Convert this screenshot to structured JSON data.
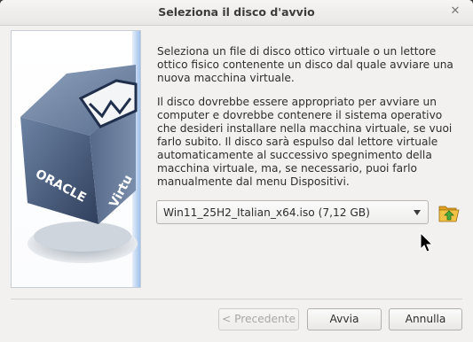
{
  "window": {
    "title": "Seleziona il disco d'avvio",
    "close_glyph": "✕"
  },
  "image": {
    "logo_text_1": "ORACLE",
    "logo_text_2": "Virtu"
  },
  "content": {
    "paragraph1": "Seleziona un file di disco ottico virtuale o un lettore ottico fisico contenente un disco dal quale avviare una nuova macchina virtuale.",
    "paragraph2": "Il disco dovrebbe essere appropriato per avviare un computer e dovrebbe contenere il sistema operativo che desideri installare nella macchina virtuale, se vuoi farlo subito. Il disco sarà espulso dal lettore virtuale automaticamente al successivo spegnimento della macchina virtuale, ma, se necessario, puoi farlo manualmente dal menu Dispositivi."
  },
  "disk_selector": {
    "selected": "Win11_25H2_Italian_x64.iso (7,12 GB)"
  },
  "buttons": {
    "previous": "< Precedente",
    "start": "Avvia",
    "cancel": "Annulla"
  },
  "icons": {
    "folder": "folder-open-icon",
    "close": "close-icon"
  }
}
